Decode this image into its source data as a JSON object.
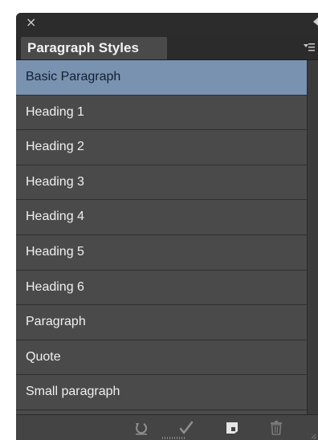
{
  "panel": {
    "close_glyph": "×",
    "tab_title": "Paragraph Styles",
    "menu_icon": "panel-menu-icon",
    "styles": [
      {
        "label": "Basic Paragraph",
        "selected": true
      },
      {
        "label": "Heading 1",
        "selected": false
      },
      {
        "label": "Heading 2",
        "selected": false
      },
      {
        "label": "Heading 3",
        "selected": false
      },
      {
        "label": "Heading 4",
        "selected": false
      },
      {
        "label": "Heading 5",
        "selected": false
      },
      {
        "label": "Heading 6",
        "selected": false
      },
      {
        "label": "Paragraph",
        "selected": false
      },
      {
        "label": "Quote",
        "selected": false
      },
      {
        "label": "Small paragraph",
        "selected": false
      }
    ],
    "footer_icons": [
      "clear-overrides-icon",
      "redefine-style-icon",
      "new-style-icon",
      "delete-style-icon"
    ]
  },
  "colors": {
    "panel_bg": "#2e2e2e",
    "row_bg": "#4a4a4a",
    "selected_bg": "#7892b0",
    "text": "#f0f0f0"
  }
}
